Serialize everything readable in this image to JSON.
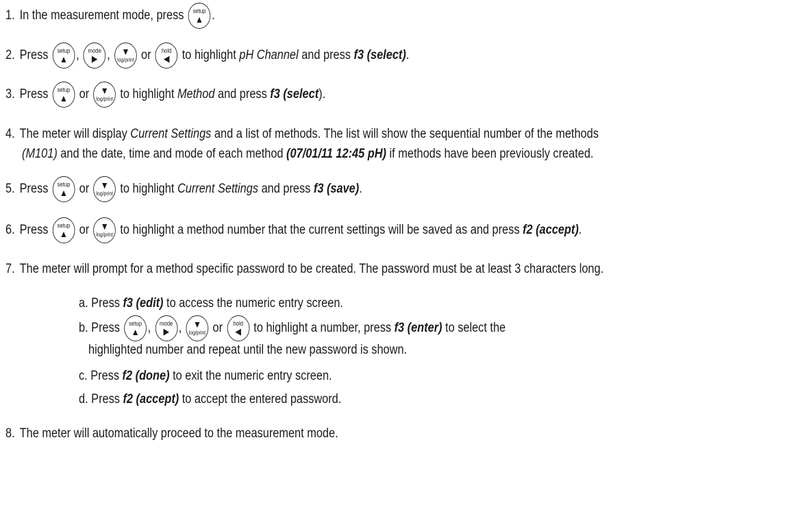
{
  "keys": {
    "setup": {
      "label": "setup",
      "arrow": "▲"
    },
    "mode": {
      "label": "mode",
      "arrow": "▶"
    },
    "logprint": {
      "label": "log/print",
      "arrow": "▼"
    },
    "hold": {
      "label": "hold",
      "arrow": "◀"
    }
  },
  "steps": {
    "s1": {
      "num": "1.",
      "t1": "In the measurement mode, press",
      "t2": "."
    },
    "s2": {
      "num": "2.",
      "t1": "Press",
      "c1": ",",
      "c2": ",",
      "or": "or",
      "t2": "to highlight",
      "em": "pH Channel",
      "t3": "and press",
      "strong": "f3 (select)",
      "end": "."
    },
    "s3": {
      "num": "3.",
      "t1": "Press",
      "or": "or",
      "t2": "to highlight",
      "em": "Method",
      "t3": "and press",
      "strong": "f3 (select",
      "end": ")."
    },
    "s4": {
      "num": "4.",
      "t1": "The meter will display",
      "em": "Current Settings",
      "t2": "and a list of methods. The list will show the sequential number of the methods",
      "em2": "(M101)",
      "t3": "and the date, time and mode of each method",
      "strong": "(07/01/11  12:45  pH)",
      "t4": "if methods have been previously created."
    },
    "s5": {
      "num": "5.",
      "t1": "Press",
      "or": "or",
      "t2": "to highlight",
      "em": "Current Settings",
      "t3": "and press",
      "strong": "f3 (save)",
      "end": "."
    },
    "s6": {
      "num": "6.",
      "t1": "Press",
      "or": "or",
      "t2": "to highlight a method number that the current settings will be saved as and press",
      "strong": "f2 (accept)",
      "end": "."
    },
    "s7": {
      "num": "7.",
      "t1": "The meter will prompt for a method specific password to be created. The password must be at least 3 characters long."
    },
    "s7a": {
      "t1": "a. Press",
      "strong": "f3 (edit)",
      "t2": "to access the numeric entry screen."
    },
    "s7b": {
      "t1": "b. Press",
      "c1": ",",
      "c2": ",",
      "or": "or",
      "t2": "to highlight a number, press",
      "strong": "f3 (enter)",
      "t3": "to select the",
      "t4": "highlighted number and repeat until the new password is shown."
    },
    "s7c": {
      "t1": "c. Press",
      "strong": "f2 (done)",
      "t2": "to exit the numeric entry screen."
    },
    "s7d": {
      "t1": "d. Press",
      "strong": "f2 (accept)",
      "t2": "to accept the entered password."
    },
    "s8": {
      "num": "8.",
      "t1": "The meter will automatically proceed to the measurement mode."
    }
  }
}
